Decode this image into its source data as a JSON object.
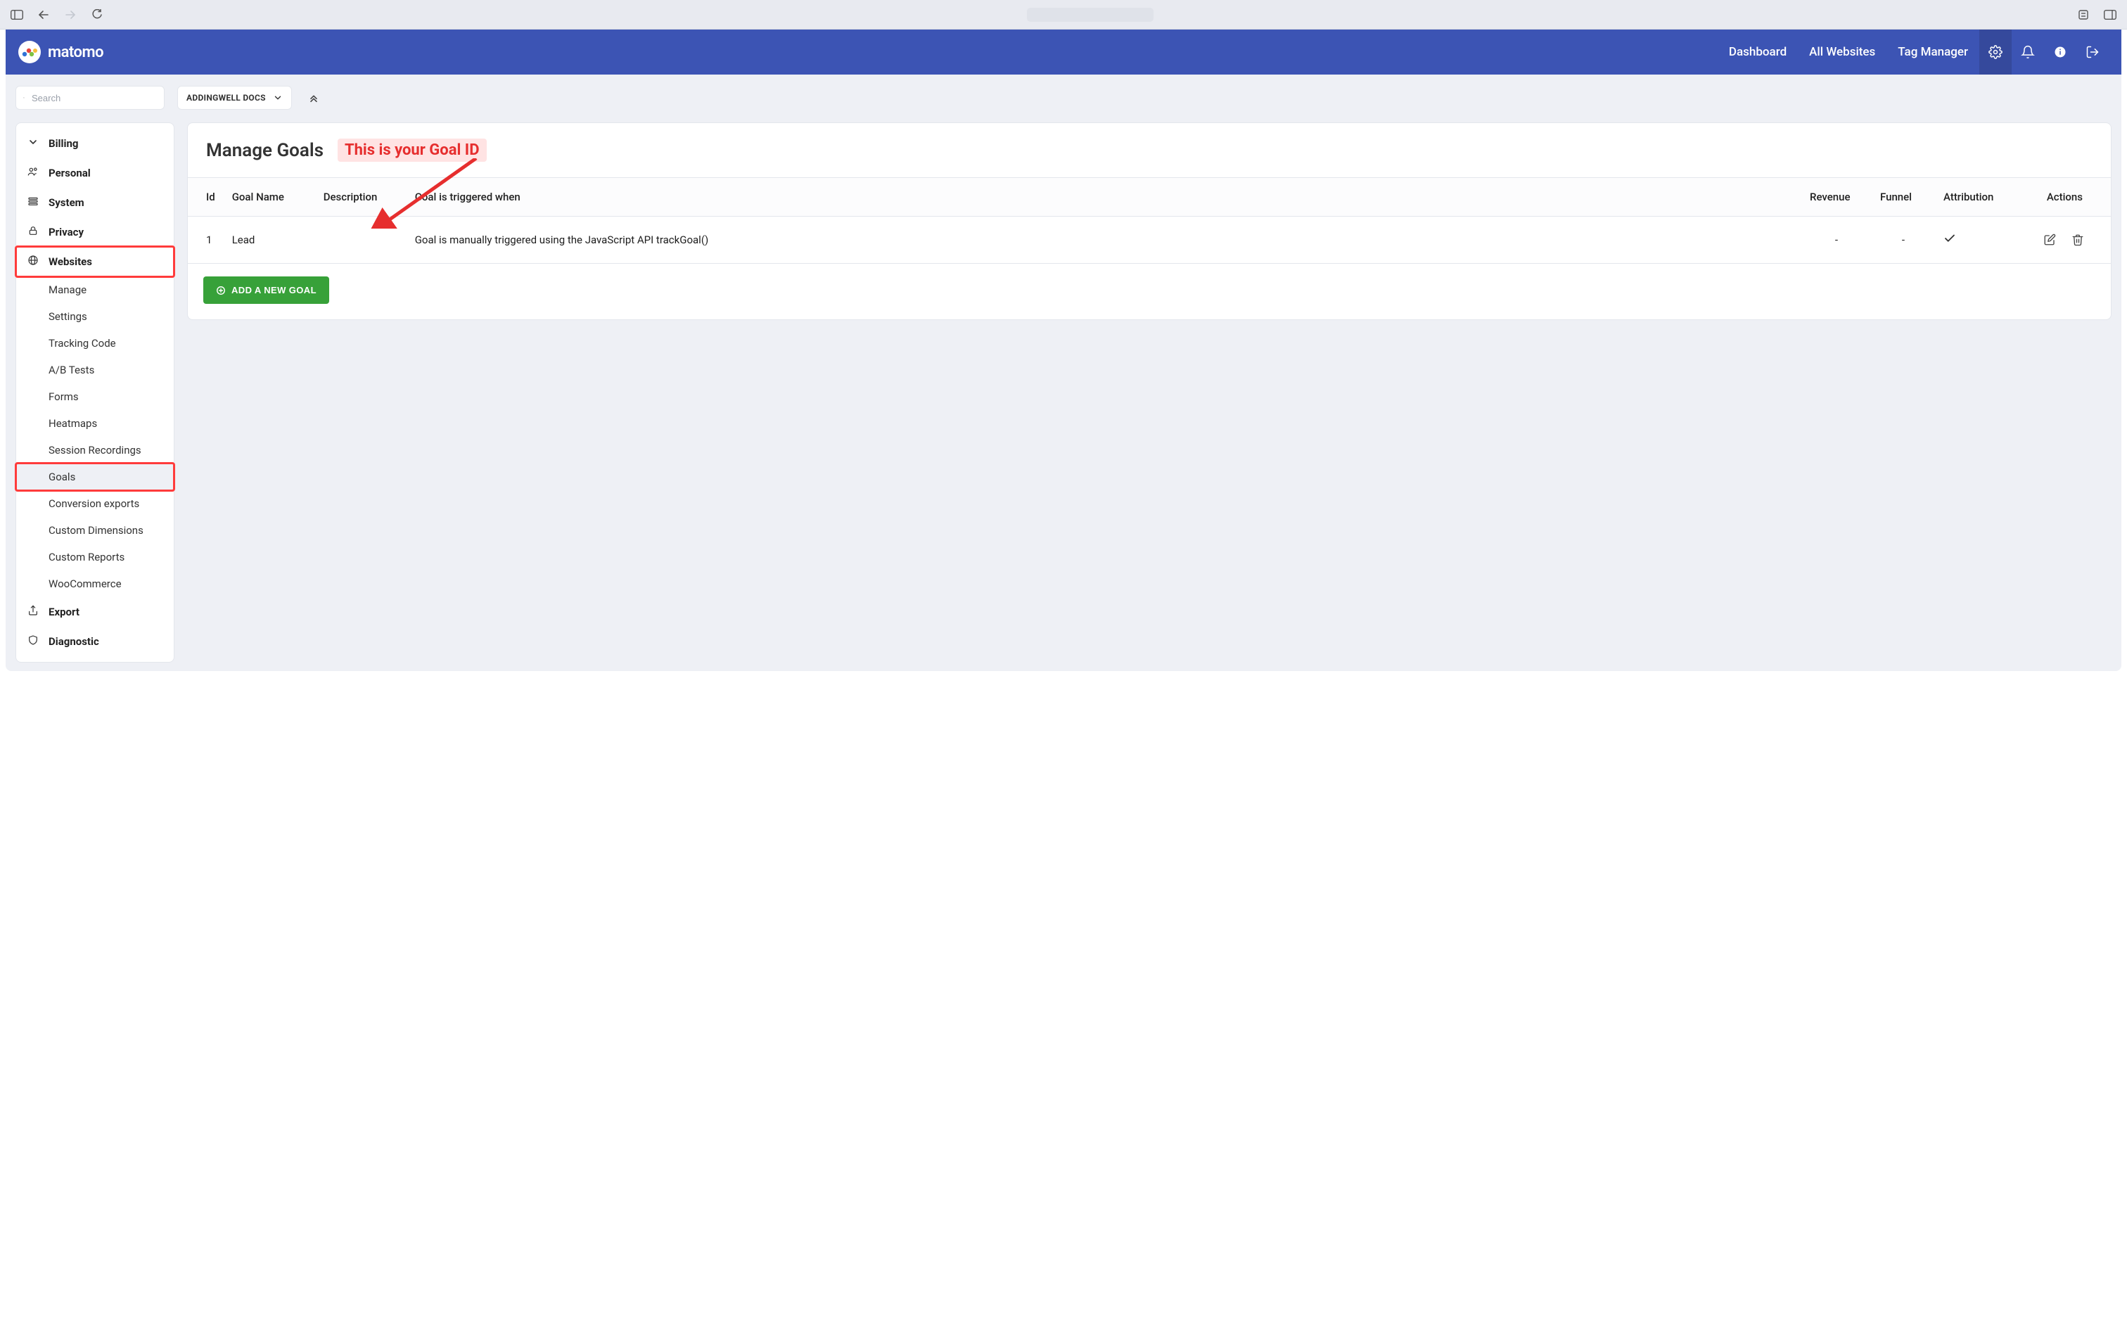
{
  "brand": {
    "name": "matomo"
  },
  "topnav": {
    "links": [
      "Dashboard",
      "All Websites",
      "Tag Manager"
    ]
  },
  "secondary_bar": {
    "search_placeholder": "Search",
    "site_selector": "ADDINGWELL DOCS"
  },
  "sidebar": {
    "sections": [
      {
        "key": "billing",
        "label": "Billing",
        "icon": "chevron-down"
      },
      {
        "key": "personal",
        "label": "Personal",
        "icon": "users"
      },
      {
        "key": "system",
        "label": "System",
        "icon": "lines"
      },
      {
        "key": "privacy",
        "label": "Privacy",
        "icon": "lock"
      },
      {
        "key": "websites",
        "label": "Websites",
        "icon": "globe",
        "highlight": true,
        "children": [
          {
            "key": "manage",
            "label": "Manage"
          },
          {
            "key": "settings",
            "label": "Settings"
          },
          {
            "key": "tracking-code",
            "label": "Tracking Code"
          },
          {
            "key": "ab-tests",
            "label": "A/B Tests"
          },
          {
            "key": "forms",
            "label": "Forms"
          },
          {
            "key": "heatmaps",
            "label": "Heatmaps"
          },
          {
            "key": "session-recordings",
            "label": "Session Recordings"
          },
          {
            "key": "goals",
            "label": "Goals",
            "active": true,
            "highlight": true
          },
          {
            "key": "conversion-exports",
            "label": "Conversion exports"
          },
          {
            "key": "custom-dimensions",
            "label": "Custom Dimensions"
          },
          {
            "key": "custom-reports",
            "label": "Custom Reports"
          },
          {
            "key": "woocommerce",
            "label": "WooCommerce"
          }
        ]
      },
      {
        "key": "export",
        "label": "Export",
        "icon": "share"
      },
      {
        "key": "diagnostic",
        "label": "Diagnostic",
        "icon": "shield"
      }
    ]
  },
  "page": {
    "title": "Manage Goals",
    "callout": "This is your Goal ID",
    "add_button": "ADD A NEW GOAL",
    "columns": {
      "id": "Id",
      "name": "Goal Name",
      "description": "Description",
      "trigger": "Goal is triggered when",
      "revenue": "Revenue",
      "funnel": "Funnel",
      "attribution": "Attribution",
      "actions": "Actions"
    },
    "rows": [
      {
        "id": "1",
        "name": "Lead",
        "description": "",
        "trigger": "Goal is manually triggered using the JavaScript API trackGoal()",
        "revenue": "-",
        "funnel": "-",
        "attribution": "check"
      }
    ]
  }
}
